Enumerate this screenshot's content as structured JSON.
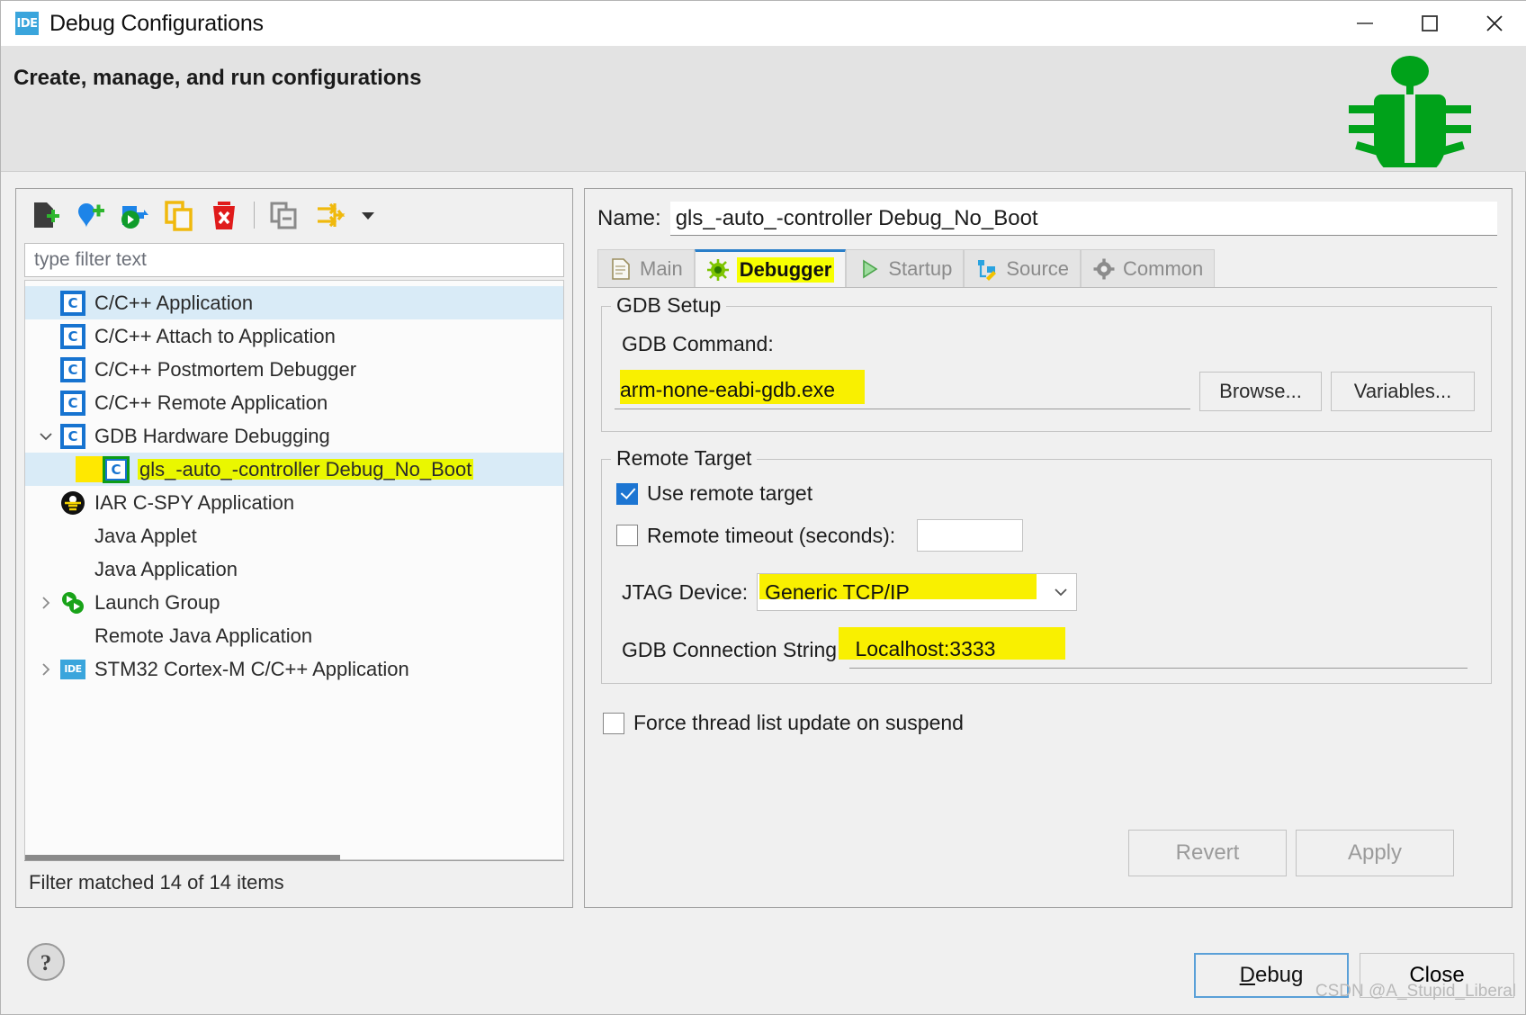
{
  "window": {
    "title": "Debug Configurations",
    "app_icon": "IDE",
    "minimize": "minimize-icon",
    "maximize": "maximize-icon",
    "close": "close-icon"
  },
  "header": {
    "title": "Create, manage, and run configurations",
    "decoration_icon": "green-bug-icon"
  },
  "left": {
    "toolbar": [
      {
        "name": "new-launch-configuration",
        "icon": "new-config-icon"
      },
      {
        "name": "new-prototype",
        "icon": "new-prototype-icon"
      },
      {
        "name": "export",
        "icon": "export-icon"
      },
      {
        "name": "duplicate",
        "icon": "duplicate-icon"
      },
      {
        "name": "delete",
        "icon": "delete-icon"
      },
      {
        "name": "collapse-all",
        "icon": "collapse-all-icon"
      },
      {
        "name": "filter-launch-configurations",
        "icon": "filter-icon"
      },
      {
        "name": "view-menu",
        "icon": "chevron-down-icon"
      }
    ],
    "filter": {
      "placeholder": "type filter text",
      "value": ""
    },
    "tree": [
      {
        "label": "C/C++ Application",
        "icon": "c-icon",
        "indent": 1,
        "twisty": "",
        "selected": true,
        "highlight": false
      },
      {
        "label": "C/C++ Attach to Application",
        "icon": "c-icon",
        "indent": 1,
        "twisty": "",
        "selected": false,
        "highlight": false
      },
      {
        "label": "C/C++ Postmortem Debugger",
        "icon": "c-icon",
        "indent": 1,
        "twisty": "",
        "selected": false,
        "highlight": false
      },
      {
        "label": "C/C++ Remote Application",
        "icon": "c-icon",
        "indent": 1,
        "twisty": "",
        "selected": false,
        "highlight": false
      },
      {
        "label": "GDB Hardware Debugging",
        "icon": "c-icon",
        "indent": 1,
        "twisty": "expanded",
        "selected": false,
        "highlight": false
      },
      {
        "label": "gls_-auto_-controller Debug_No_Boot",
        "icon": "c-icon-green-box",
        "indent": 2,
        "twisty": "",
        "selected": true,
        "highlight": true
      },
      {
        "label": "IAR C-SPY Application",
        "icon": "cspy-icon",
        "indent": 1,
        "twisty": "",
        "selected": false,
        "highlight": false
      },
      {
        "label": "Java Applet",
        "icon": "none",
        "indent": 1,
        "twisty": "",
        "selected": false,
        "highlight": false
      },
      {
        "label": "Java Application",
        "icon": "none",
        "indent": 1,
        "twisty": "",
        "selected": false,
        "highlight": false
      },
      {
        "label": "Launch Group",
        "icon": "launch-group-icon",
        "indent": 1,
        "twisty": "collapsed",
        "selected": false,
        "highlight": false
      },
      {
        "label": "Remote Java Application",
        "icon": "none",
        "indent": 1,
        "twisty": "",
        "selected": false,
        "highlight": false
      },
      {
        "label": "STM32 Cortex-M C/C++ Application",
        "icon": "ide-icon",
        "indent": 1,
        "twisty": "collapsed",
        "selected": false,
        "highlight": false
      }
    ],
    "status": "Filter matched 14 of 14 items"
  },
  "right": {
    "name_label": "Name:",
    "name_value": "gls_-auto_-controller Debug_No_Boot",
    "tabs": [
      {
        "label": "Main",
        "icon": "document-icon",
        "active": false
      },
      {
        "label": "Debugger",
        "icon": "bug-gear-icon",
        "active": true
      },
      {
        "label": "Startup",
        "icon": "play-icon",
        "active": false
      },
      {
        "label": "Source",
        "icon": "source-icon",
        "active": false
      },
      {
        "label": "Common",
        "icon": "gear-icon",
        "active": false
      }
    ],
    "gdb_setup": {
      "group_title": "GDB Setup",
      "command_label": "GDB Command:",
      "command_value": "arm-none-eabi-gdb.exe",
      "browse_label": "Browse...",
      "variables_label": "Variables..."
    },
    "remote_target": {
      "group_title": "Remote Target",
      "use_remote_label": "Use remote target",
      "use_remote_checked": true,
      "timeout_label": "Remote timeout (seconds):",
      "timeout_checked": false,
      "timeout_value": "",
      "jtag_label": "JTAG Device:",
      "jtag_value": "Generic TCP/IP",
      "connection_label": "GDB Connection String:",
      "connection_value": "Localhost:3333"
    },
    "force_thread_label": "Force thread list update on suspend",
    "force_thread_checked": false,
    "revert_label": "Revert",
    "apply_label": "Apply"
  },
  "footer": {
    "help_icon": "help-icon",
    "debug_label": "Debug",
    "close_label": "Close",
    "watermark": "CSDN @A_Stupid_Liberal"
  },
  "colors": {
    "accent_blue": "#1c75d2",
    "highlight_yellow": "#f9f000",
    "bug_green": "#00a21a",
    "window_bg": "#f0f0f0"
  }
}
